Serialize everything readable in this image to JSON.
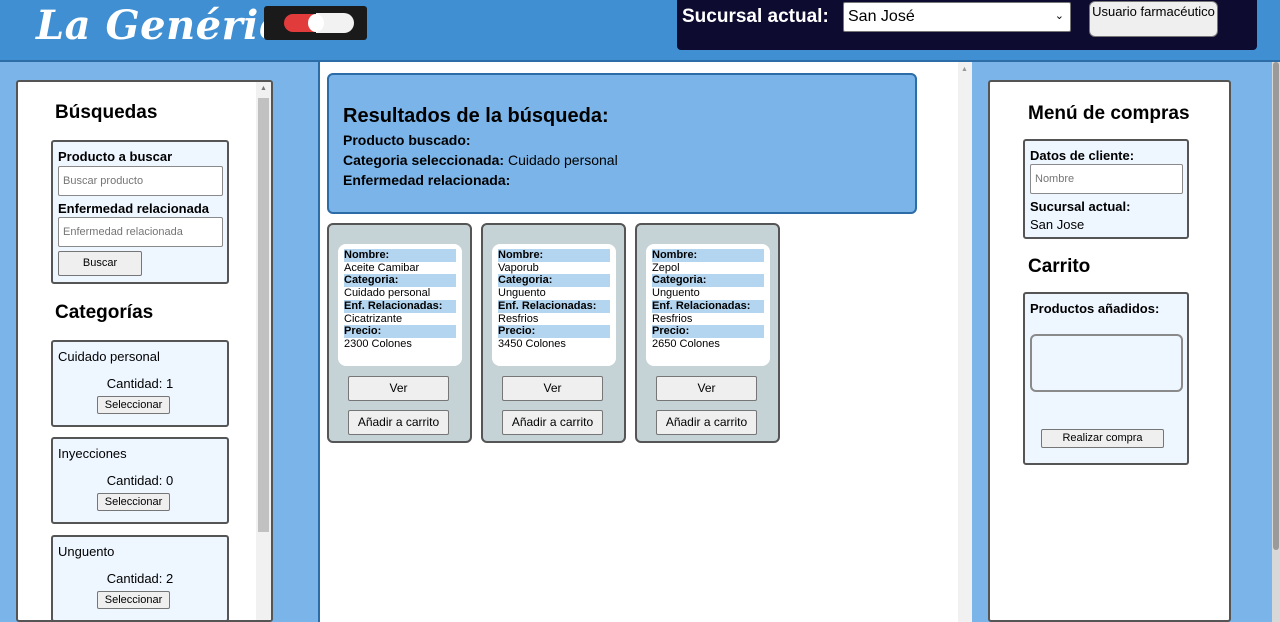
{
  "header": {
    "logo_text": "La Genérica",
    "branch_label": "Sucursal actual:",
    "branch_selected": "San José",
    "user_button_label": "Usuario farmacéutico"
  },
  "searches": {
    "title": "Búsquedas",
    "product_label": "Producto a buscar",
    "product_placeholder": "Buscar producto",
    "disease_label": "Enfermedad relacionada",
    "disease_placeholder": "Enfermedad relacionada",
    "search_button": "Buscar"
  },
  "categories": {
    "title": "Categorías",
    "items": [
      {
        "name": "Cuidado personal",
        "quantity": "Cantidad: 1",
        "button": "Seleccionar"
      },
      {
        "name": "Inyecciones",
        "quantity": "Cantidad: 0",
        "button": "Seleccionar"
      },
      {
        "name": "Unguento",
        "quantity": "Cantidad: 2",
        "button": "Seleccionar"
      }
    ]
  },
  "results": {
    "title": "Resultados de la búsqueda:",
    "product_label": "Producto buscado:",
    "product_value": "",
    "category_label": "Categoria seleccionada:",
    "category_value": "Cuidado personal",
    "disease_label": "Enfermedad relacionada:",
    "disease_value": ""
  },
  "product_labels": {
    "name": "Nombre:",
    "category": "Categoria:",
    "diseases": "Enf. Relacionadas:",
    "price": "Precio:",
    "view_button": "Ver",
    "add_button": "Añadir a carrito"
  },
  "products": [
    {
      "name": "Aceite Camibar",
      "category": "Cuidado personal",
      "diseases": "Cicatrizante",
      "price": "2300 Colones"
    },
    {
      "name": "Vaporub",
      "category": "Unguento",
      "diseases": "Resfrios",
      "price": "3450 Colones"
    },
    {
      "name": "Zepol",
      "category": "Unguento",
      "diseases": "Resfrios",
      "price": "2650 Colones"
    }
  ],
  "purchase_menu": {
    "title": "Menú de compras",
    "client_label": "Datos de cliente:",
    "name_placeholder": "Nombre",
    "branch_label": "Sucursal actual:",
    "branch_value": "San Jose",
    "cart_title": "Carrito",
    "added_products_label": "Productos añadidos:",
    "checkout_button": "Realizar compra"
  }
}
